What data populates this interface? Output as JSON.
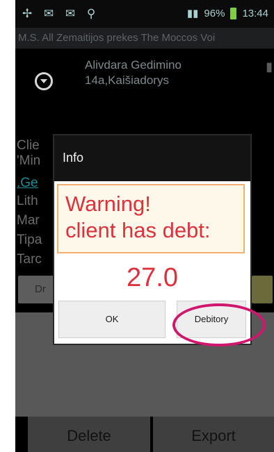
{
  "status_bar": {
    "left_icons": "✢ ✉ ✉ ⚲",
    "signal": "▮▮",
    "battery_pct": "96%",
    "time": "13:44"
  },
  "marquee_text": "M.S. All Zemaitijos prekes The Moccos Voi",
  "address": {
    "line1": "Alivdara Gedimino",
    "line2": "14a,Kaišiadorys"
  },
  "background_lines": [
    "Clie",
    "'Min",
    ".Ge",
    "Lith",
    "Mar",
    "Tipa",
    "Tarc"
  ],
  "background_button": "Dr",
  "bottom_bar": {
    "delete": "Delete",
    "export": "Export"
  },
  "dialog": {
    "title": "Info",
    "warning_line1": "Warning!",
    "warning_line2": "client has debt:",
    "amount": "27.0",
    "ok_label": "OK",
    "debitory_label": "Debitory"
  },
  "colors": {
    "warning_red": "#e0303c",
    "warn_border": "#f3b06d",
    "highlight": "#d0166d"
  }
}
